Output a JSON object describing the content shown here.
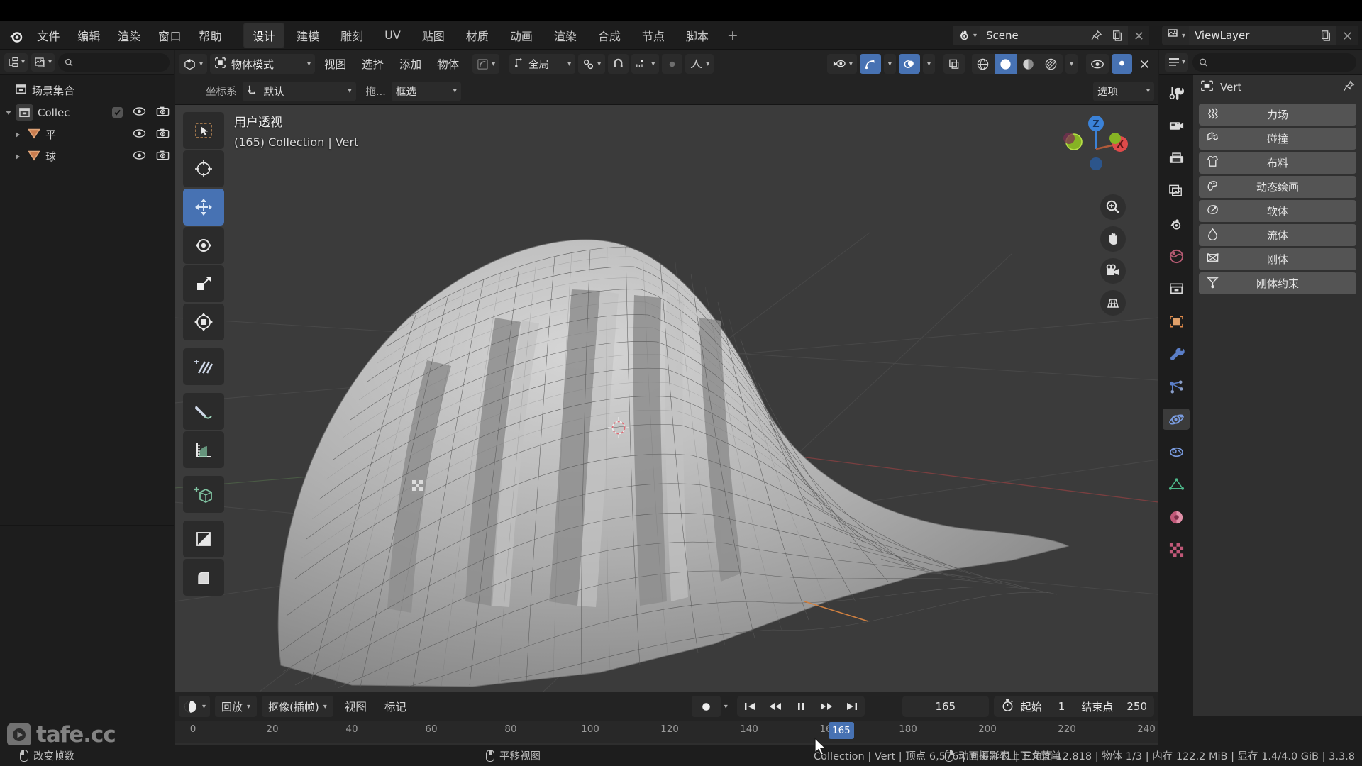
{
  "app": {
    "title": "Blender",
    "version": "3.3.8"
  },
  "menubar": {
    "logo_icon": "blender-logo-icon",
    "menus": [
      "文件",
      "编辑",
      "渲染",
      "窗口",
      "帮助"
    ],
    "workspace_tabs": [
      "设计",
      "建模",
      "雕刻",
      "UV",
      "贴图",
      "材质",
      "动画",
      "渲染",
      "合成",
      "节点",
      "脚本"
    ],
    "workspace_active": "设计",
    "add_tab_label": "+",
    "scene": {
      "icon": "scene-icon",
      "value": "Scene",
      "pin_icon": "pin-icon",
      "copy_icon": "new-scene-icon",
      "close_icon": "close-icon"
    },
    "viewlayer": {
      "icon": "viewlayer-icon",
      "value": "ViewLayer",
      "copy_icon": "new-viewlayer-icon",
      "close_icon": "close-icon"
    }
  },
  "outliner": {
    "display_mode_icon": "outliner-filter-icon",
    "view_layer_icon": "view-layer-icon",
    "search_placeholder": "",
    "search_value": "",
    "rows": [
      {
        "label": "场景集合",
        "icon": "collection-icon",
        "level": 0,
        "expanded": false,
        "has_checkbox": false,
        "has_eye": false,
        "has_camera": false
      },
      {
        "label": "Collec",
        "icon": "collection-icon",
        "level": 1,
        "expanded": true,
        "has_checkbox": true,
        "has_eye": true,
        "has_camera": true
      },
      {
        "label": "平",
        "icon": "mesh-data-icon",
        "level": 2,
        "expanded": false,
        "has_checkbox": false,
        "has_eye": true,
        "has_camera": true
      },
      {
        "label": "球",
        "icon": "mesh-data-icon",
        "level": 2,
        "expanded": false,
        "has_checkbox": false,
        "has_eye": true,
        "has_camera": true
      }
    ]
  },
  "viewport": {
    "header_row1": {
      "editor_type_icon": "editor-type-3dview-icon",
      "mode": "物体模式",
      "mode_icon": "object-mode-icon",
      "menus": [
        "视图",
        "选择",
        "添加",
        "物体"
      ],
      "mode_toggle_icon": "object-interaction-icon",
      "orientation_label": "全局",
      "orientation_icon": "orientation-icon",
      "snap_icon": "snap-magnet-icon",
      "snap_increment_icon": "snap-increment-icon",
      "pivot_icon": "pivot-icon",
      "proportional_icon": "proportional-editing-icon",
      "proportional_falloff_icon": "falloff-curve-icon",
      "visibility_icon": "object-visibility-icon",
      "gizmo_icon": "gizmo-icon",
      "overlay_icon": "overlays-icon",
      "xray_icon": "xray-toggle-icon",
      "shading_wireframe_icon": "shading-wireframe-icon",
      "shading_solid_icon": "shading-solid-icon",
      "shading_material_icon": "shading-material-icon",
      "shading_rendered_icon": "shading-rendered-icon",
      "shading_active": "shading-solid-icon",
      "filter_eye_icon": "filter-eye-icon",
      "close_icon": "close-icon"
    },
    "header_row2": {
      "transform_label": "坐标系",
      "transform_value": "默认",
      "transform_icon": "transform-orientation-icon",
      "drag_label": "拖...",
      "drag_value": "框选",
      "options_label": "选项"
    },
    "overlay_line1": "用户透视",
    "overlay_line2": "(165) Collection | Vert",
    "toolbar_icons": [
      "tweak-select-box-icon",
      "cursor-icon",
      "move-icon",
      "rotate-icon",
      "scale-icon",
      "transform-icon",
      "annotate-icon",
      "measure-icon",
      "add-cube-icon",
      "shear-icon",
      "bevel-icon"
    ],
    "toolbar_active_index": 2,
    "gizmo_axes": [
      {
        "label": "Z",
        "color": "#3b82d8"
      },
      {
        "label": "X",
        "color": "#e04a4a"
      },
      {
        "label": "Y",
        "color": "#86b324"
      }
    ],
    "nav_buttons": [
      "zoom-icon",
      "pan-hand-icon",
      "camera-view-icon",
      "ortho-persp-grid-icon"
    ],
    "background_color": "#3b3b3b"
  },
  "properties": {
    "editor_type_icon": "editor-type-properties-icon",
    "search_placeholder": "",
    "search_value": "",
    "breadcrumb": "Vert",
    "breadcrumb_icon": "object-icon",
    "pin_icon": "pin-icon",
    "tabs": [
      "tool-icon",
      "render-icon",
      "output-icon",
      "view-layer-icon",
      "scene-icon",
      "world-icon",
      "collection-icon",
      "object-icon",
      "modifiers-wrench-icon",
      "particles-icon",
      "physics-icon",
      "object-constraints-icon",
      "object-data-icon",
      "material-icon",
      "texture-icon"
    ],
    "active_tab": "physics-icon",
    "physics_buttons": [
      {
        "label": "力场",
        "icon": "force-field-icon"
      },
      {
        "label": "碰撞",
        "icon": "collision-icon"
      },
      {
        "label": "布料",
        "icon": "cloth-icon"
      },
      {
        "label": "动态绘画",
        "icon": "dynamic-paint-icon"
      },
      {
        "label": "软体",
        "icon": "soft-body-icon"
      },
      {
        "label": "流体",
        "icon": "fluid-icon"
      },
      {
        "label": "刚体",
        "icon": "rigid-body-icon"
      },
      {
        "label": "刚体约束",
        "icon": "rigid-body-constraint-icon"
      }
    ]
  },
  "timeline": {
    "editor_type_icon": "editor-type-timeline-icon",
    "menus": [
      {
        "label": "回放",
        "has_chevron": true
      },
      {
        "label": "抠像(插帧)",
        "has_chevron": true
      },
      {
        "label": "视图",
        "has_chevron": false
      },
      {
        "label": "标记",
        "has_chevron": false
      }
    ],
    "record_icon": "auto-keying-record-icon",
    "transport": [
      "jump-start-icon",
      "prev-keyframe-icon",
      "pause-icon",
      "next-keyframe-icon",
      "jump-end-icon"
    ],
    "current_frame": "165",
    "frame_icon": "stopwatch-icon",
    "start_label": "起始",
    "start_value": "1",
    "end_label": "结束点",
    "end_value": "250",
    "ruler_ticks": [
      "0",
      "20",
      "40",
      "60",
      "80",
      "100",
      "120",
      "140",
      "16",
      "180",
      "200",
      "220",
      "240"
    ],
    "playhead_label": "165"
  },
  "statusbar": {
    "hints": [
      {
        "mouse": "left",
        "label": "改变帧数"
      },
      {
        "mouse": "middle",
        "label": "平移视图"
      },
      {
        "mouse": "right",
        "label": "动画摄影表上下文菜单"
      }
    ],
    "stats": "Collection | Vert | 顶点 6,576 | 面 6,441 | 三角面 12,818 | 物体 1/3 | 内存 122.2 MiB | 显存 1.4/4.0 GiB | 3.3.8"
  },
  "watermark": {
    "text": "tafe.cc",
    "icon": "play-badge-icon"
  },
  "colors": {
    "accent_blue": "#4772b3",
    "panel_bg": "#303030",
    "editor_bg": "#1d1d1d",
    "header_bg": "#232323",
    "viewport_bg": "#3b3b3b",
    "button_gray": "#545454"
  }
}
